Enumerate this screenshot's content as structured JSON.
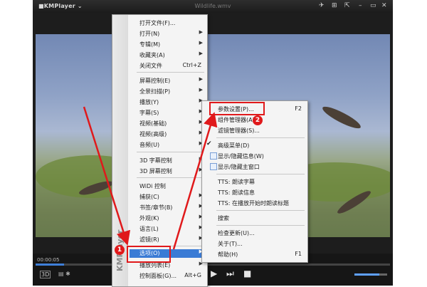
{
  "app": {
    "logo": "■KMPlayer ⌄",
    "window_title": "Wildlife.wmv",
    "controls": [
      "✈",
      "⊞",
      "⇱",
      "–",
      "▭",
      "✕"
    ]
  },
  "player": {
    "time": "00:00:05",
    "seek_progress": 0.08,
    "volume": 0.75,
    "badge_3d": "3D",
    "small_icons": "▤ ✱",
    "buttons": {
      "play": "▶",
      "next": "⏭",
      "stop": "■"
    }
  },
  "main_menu": {
    "side_label": "KMPlayer",
    "items": [
      {
        "label": "打开文件(F)...",
        "shortcut": "",
        "submenu": false
      },
      {
        "label": "打开(N)",
        "shortcut": "",
        "submenu": true
      },
      {
        "label": "专辑(M)",
        "shortcut": "",
        "submenu": true
      },
      {
        "label": "收藏夹(A)",
        "shortcut": "",
        "submenu": true
      },
      {
        "label": "关闭文件",
        "shortcut": "Ctrl+Z",
        "submenu": false
      },
      {
        "label": "屏幕控制(E)",
        "shortcut": "",
        "submenu": true
      },
      {
        "label": "全景扫描(P)",
        "shortcut": "",
        "submenu": true
      },
      {
        "label": "播放(Y)",
        "shortcut": "",
        "submenu": true
      },
      {
        "label": "字幕(S)",
        "shortcut": "",
        "submenu": true
      },
      {
        "label": "视频(基础)",
        "shortcut": "",
        "submenu": true
      },
      {
        "label": "视频(高级)",
        "shortcut": "",
        "submenu": true
      },
      {
        "label": "音频(U)",
        "shortcut": "",
        "submenu": true
      },
      {
        "label": "3D 字幕控制",
        "shortcut": "",
        "submenu": true
      },
      {
        "label": "3D 屏幕控制",
        "shortcut": "",
        "submenu": true
      },
      {
        "label": "WiDi 控制",
        "shortcut": "",
        "submenu": false
      },
      {
        "label": "捕获(C)",
        "shortcut": "",
        "submenu": true
      },
      {
        "label": "书签/章节(B)",
        "shortcut": "",
        "submenu": true
      },
      {
        "label": "外观(K)",
        "shortcut": "",
        "submenu": true
      },
      {
        "label": "语言(L)",
        "shortcut": "",
        "submenu": true
      },
      {
        "label": "滤镜(R)",
        "shortcut": "",
        "submenu": true
      },
      {
        "label": "选项(O)",
        "shortcut": "",
        "submenu": true,
        "selected": true
      },
      {
        "label": "播放列表(E)",
        "shortcut": "",
        "submenu": true
      },
      {
        "label": "控制面板(G)...",
        "shortcut": "Alt+G",
        "submenu": false
      }
    ]
  },
  "sub_menu": {
    "items": [
      {
        "label": "参数设置(P)...",
        "shortcut": "F2"
      },
      {
        "label": "组件管理器(A)...",
        "shortcut": ""
      },
      {
        "label": "滤镜管理器(S)...",
        "shortcut": ""
      },
      {
        "label": "高级菜单(D)",
        "shortcut": "",
        "checked": true
      },
      {
        "label": "显示/隐藏信息(W)",
        "shortcut": "",
        "checkbox": true
      },
      {
        "label": "显示/隐藏主窗口",
        "shortcut": "",
        "checkbox": true
      },
      {
        "label": "TTS: 朗读字幕",
        "shortcut": ""
      },
      {
        "label": "TTS: 朗读信息",
        "shortcut": ""
      },
      {
        "label": "TTS: 在播放开始时朗读标题",
        "shortcut": ""
      },
      {
        "label": "搜索",
        "shortcut": ""
      },
      {
        "label": "检查更新(U)...",
        "shortcut": ""
      },
      {
        "label": "关于(T)...",
        "shortcut": ""
      },
      {
        "label": "帮助(H)",
        "shortcut": "F1"
      }
    ]
  },
  "annotations": {
    "step1": "1",
    "step2": "2",
    "color": "#e0191b"
  }
}
